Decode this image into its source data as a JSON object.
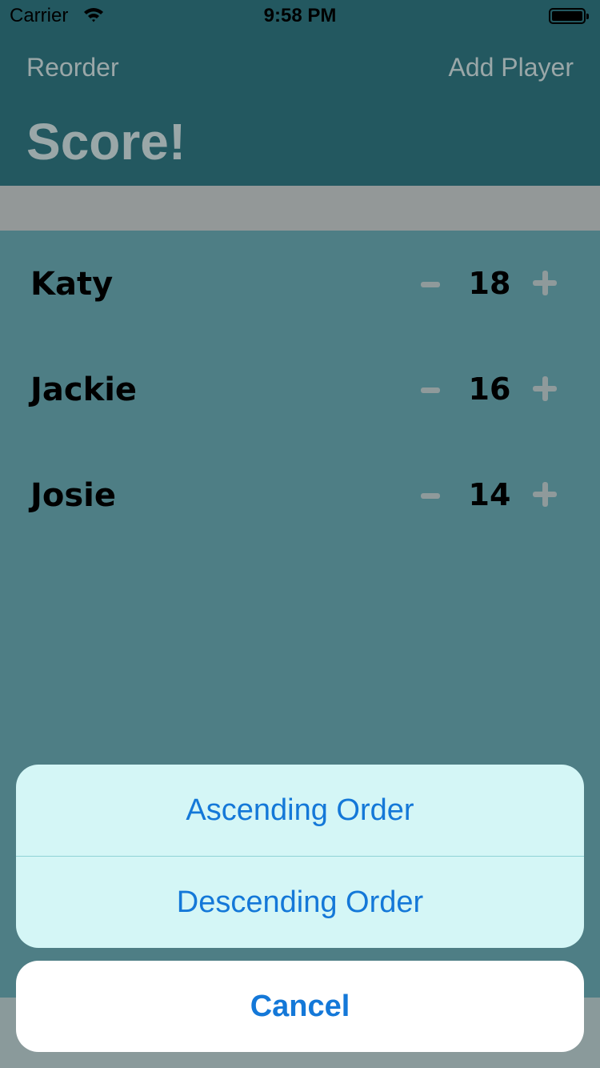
{
  "status_bar": {
    "carrier": "Carrier",
    "time": "9:58 PM"
  },
  "nav": {
    "reorder": "Reorder",
    "add_player": "Add Player",
    "title": "Score!"
  },
  "players": [
    {
      "name": "Katy",
      "score": "18"
    },
    {
      "name": "Jackie",
      "score": "16"
    },
    {
      "name": "Josie",
      "score": "14"
    }
  ],
  "action_sheet": {
    "ascending": "Ascending Order",
    "descending": "Descending Order",
    "cancel": "Cancel"
  },
  "colors": {
    "nav_bg": "#235860",
    "list_bg": "#4e7e85",
    "sheet_bg": "#d4f6f6",
    "action_blue": "#1478d8",
    "muted_gray": "#9aa7a8"
  },
  "icons": {
    "wifi": "wifi-icon",
    "battery": "battery-icon",
    "minus": "minus-icon",
    "plus": "plus-icon"
  }
}
